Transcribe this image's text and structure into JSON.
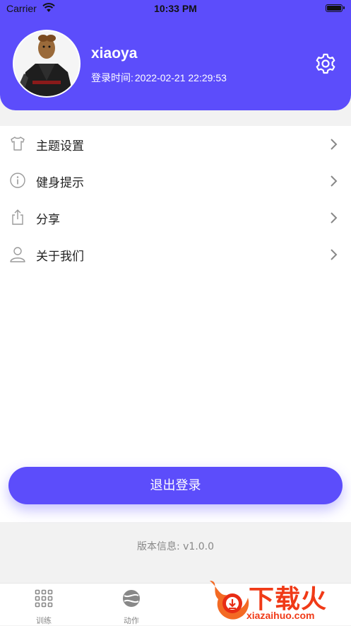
{
  "status_bar": {
    "carrier": "Carrier",
    "time": "10:33 PM"
  },
  "profile": {
    "username": "xiaoya",
    "login_time_label": "登录时间:",
    "login_time_value": "2022-02-21 22:29:53"
  },
  "menu": {
    "items": [
      {
        "label": "主题设置",
        "icon": "tshirt-icon"
      },
      {
        "label": "健身提示",
        "icon": "info-icon"
      },
      {
        "label": "分享",
        "icon": "share-icon"
      },
      {
        "label": "关于我们",
        "icon": "user-icon"
      }
    ]
  },
  "logout_label": "退出登录",
  "version": {
    "label": "版本信息:",
    "value": "v1.0.0"
  },
  "tabbar": {
    "items": [
      {
        "label": "训练",
        "icon": "grid-icon"
      },
      {
        "label": "动作",
        "icon": "ball-icon"
      }
    ]
  },
  "watermark": {
    "text": "下载火",
    "url": "xiazaihuo.com"
  },
  "colors": {
    "accent": "#5c4dfb",
    "background": "#f2f2f2",
    "watermark": "#f03a17"
  }
}
